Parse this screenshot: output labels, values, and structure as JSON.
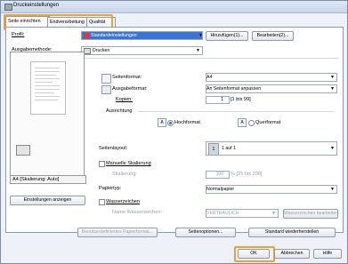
{
  "window": {
    "title": "Druckeinstellungen"
  },
  "tabs": [
    {
      "label": "Seite einrichten"
    },
    {
      "label": "Endverarbeitung"
    },
    {
      "label": "Qualität"
    }
  ],
  "profile": {
    "label": "Profil:",
    "value": "Standardeinstellungen",
    "add_button": "Hinzufügen(1)...",
    "edit_button": "Bearbeiten(2)..."
  },
  "output": {
    "label": "Ausgabemethode:",
    "value": "Drucken"
  },
  "preview": {
    "caption": "A4 [Skalierung: Auto]",
    "view_button": "Einstellungen anzeigen"
  },
  "page_format": {
    "label": "Seitenformat:",
    "value": "A4"
  },
  "output_format": {
    "label": "Ausgabeformat:",
    "value": "An Seitenformat anpassen"
  },
  "copies": {
    "label": "Kopien:",
    "value": "1",
    "range": "[1 bis 99]"
  },
  "orientation": {
    "label": "Ausrichtung",
    "portrait": "Hochformat",
    "landscape": "Querformat",
    "icon_letter": "A"
  },
  "page_layout": {
    "label": "Seitenlayout:",
    "value": "1 auf 1",
    "icon_text": "1"
  },
  "manual_scaling": {
    "label": "Manuelle Skalierung",
    "field_label": "Skalierung:",
    "value": "100",
    "range": "% [25 bis 200]"
  },
  "paper_type": {
    "label": "Papiertyp:",
    "value": "Normalpapier"
  },
  "watermark": {
    "label": "Wasserzeichen",
    "name_label": "Name Wasserzeichen:",
    "value": "VERTRAULICH",
    "edit_button": "Wasserzeichen bearbeiten..."
  },
  "bottom_buttons": {
    "custom_paper": "Benutzerdefiniertes Papierformat...",
    "page_options": "Seitenoptionen...",
    "restore_default": "Standard wiederherstellen"
  },
  "dialog": {
    "ok": "OK",
    "cancel": "Abbrechen",
    "help": "Hilfe"
  }
}
